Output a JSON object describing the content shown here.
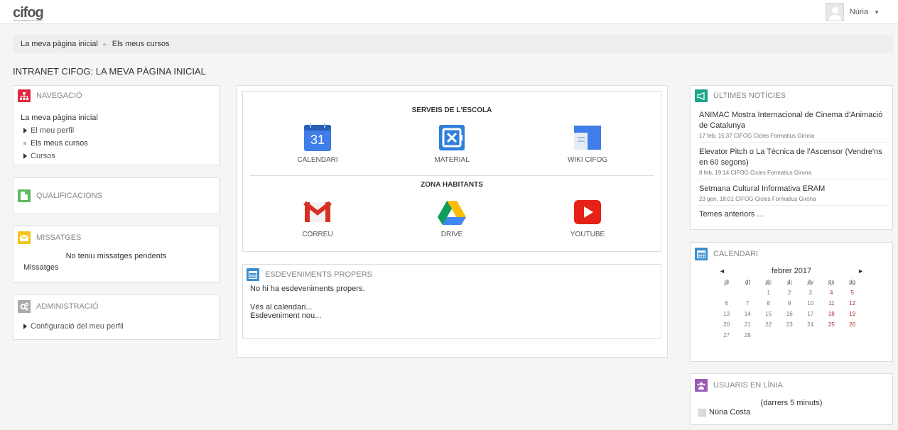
{
  "header": {
    "logo_text": "cifog",
    "logo_tagline": "CICLES FORMATIUS GIRONA",
    "user_name": "Núria",
    "caret": "▼"
  },
  "breadcrumb": {
    "items": [
      "La meva pàgina inicial",
      "Els meus cursos"
    ],
    "separator": "►"
  },
  "page_title": "INTRANET CIFOG: LA MEVA PÀGINA INICIAL",
  "navigation": {
    "title": "NAVEGACIÓ",
    "home": "La meva pàgina inicial",
    "items": [
      "El meu perfil",
      "Els meus cursos",
      "Cursos"
    ]
  },
  "grades": {
    "title": "QUALIFICACIONS"
  },
  "messages": {
    "title": "MISSATGES",
    "empty": "No teniu missatges pendents",
    "link": "Missatges"
  },
  "admin": {
    "title": "ADMINISTRACIÓ",
    "items": [
      "Configuració del meu perfil"
    ]
  },
  "services": {
    "heading1": "SERVEIS DE L'ESCOLA",
    "row1": [
      {
        "label": "CALENDARI",
        "icon": "calendar-icon",
        "number": "31"
      },
      {
        "label": "MATERIAL",
        "icon": "drive-app-icon"
      },
      {
        "label": "WIKI CIFOG",
        "icon": "sites-icon"
      }
    ],
    "heading2": "ZONA HABITANTS",
    "row2": [
      {
        "label": "CORREU",
        "icon": "gmail-icon"
      },
      {
        "label": "DRIVE",
        "icon": "google-drive-icon"
      },
      {
        "label": "YOUTUBE",
        "icon": "youtube-icon"
      }
    ]
  },
  "events": {
    "title": "ESDEVENIMENTS PROPERS",
    "empty": "No hi ha esdeveniments propers.",
    "links": [
      "Vés al calendari...",
      "Esdeveniment nou..."
    ]
  },
  "news": {
    "title": "ÚLTIMES NOTÍCIES",
    "items": [
      {
        "title": "ANIMAC Mostra Internacional de Cinema d'Animació de Catalunya",
        "meta": "17 feb, 15:37  CIFOG Cicles Formatius Girona"
      },
      {
        "title": "Elevator Pitch o La Tècnica de l'Ascensor (Vendre'ns en 60 segons)",
        "meta": "8 feb, 19:14  CIFOG Cicles Formatius Girona"
      },
      {
        "title": "Setmana Cultural Informativa ERAM",
        "meta": "23 gen, 18:01  CIFOG Cicles Formatius Girona"
      }
    ],
    "more": "Temes anteriors ..."
  },
  "calendar": {
    "title": "CALENDARI",
    "month": "febrer 2017",
    "prev": "◄",
    "next": "►",
    "days": [
      "dl",
      "dt",
      "dc",
      "dj",
      "dv",
      "ds",
      "dg"
    ],
    "weeks": [
      [
        "",
        "",
        "1",
        "2",
        "3",
        "4",
        "5"
      ],
      [
        "6",
        "7",
        "8",
        "9",
        "10",
        "11",
        "12"
      ],
      [
        "13",
        "14",
        "15",
        "16",
        "17",
        "18",
        "19"
      ],
      [
        "20",
        "21",
        "22",
        "23",
        "24",
        "25",
        "26"
      ],
      [
        "27",
        "28",
        "",
        "",
        "",
        "",
        ""
      ]
    ]
  },
  "online": {
    "title": "USUARIS EN LÍNIA",
    "subtitle": "(darrers 5 minuts)",
    "users": [
      "Núria Costa"
    ]
  },
  "colors": {
    "nav": "#e0283f",
    "grades": "#5cb85c",
    "messages": "#f0c419",
    "admin": "#aaaaaa",
    "events": "#3a8fd0",
    "news": "#1aa58a",
    "calendar": "#3a8fd0",
    "online": "#9b59b6"
  }
}
